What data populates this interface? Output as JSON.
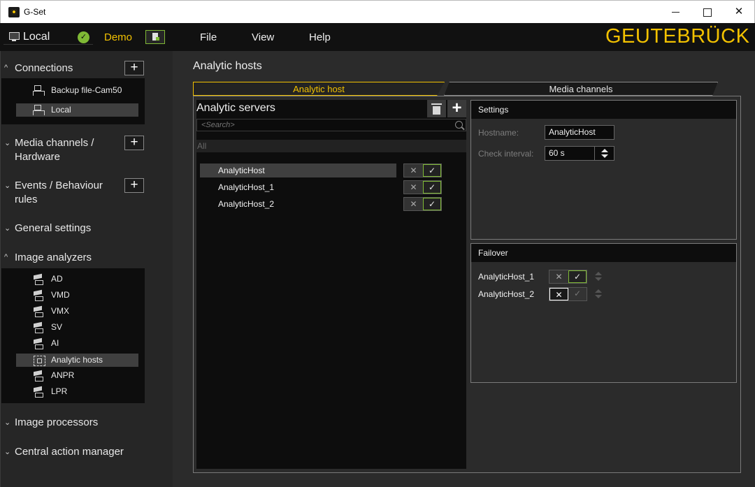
{
  "window": {
    "title": "G-Set",
    "minimize_glyph": "",
    "maximize_glyph": "",
    "close_glyph": "✕"
  },
  "menubar": {
    "connection": "Local",
    "connection_status_glyph": "✓",
    "demo": "Demo",
    "file": "File",
    "view": "View",
    "help": "Help",
    "brand": "GEUTEBRÜCK"
  },
  "sidebar": {
    "connections": {
      "title": "Connections",
      "add": "+",
      "items": [
        {
          "label": "Backup file-Cam50",
          "icon": "network-icon"
        },
        {
          "label": "Local",
          "icon": "network-icon",
          "selected": true
        }
      ]
    },
    "media_channels": {
      "title_line1": "Media channels /",
      "title_line2": "Hardware",
      "add": "+"
    },
    "events": {
      "title_line1": "Events / Behaviour",
      "title_line2": "rules",
      "add": "+"
    },
    "general_settings": {
      "title": "General settings"
    },
    "image_analyzers": {
      "title": "Image analyzers",
      "items": [
        {
          "label": "AD",
          "icon": "camera-analyzer-icon"
        },
        {
          "label": "VMD",
          "icon": "camera-analyzer-icon"
        },
        {
          "label": "VMX",
          "icon": "camera-analyzer-icon"
        },
        {
          "label": "SV",
          "icon": "camera-analyzer-icon"
        },
        {
          "label": "AI",
          "icon": "camera-analyzer-icon"
        },
        {
          "label": "Analytic hosts",
          "icon": "analytic-hosts-icon",
          "selected": true
        },
        {
          "label": "ANPR",
          "icon": "camera-analyzer-icon"
        },
        {
          "label": "LPR",
          "icon": "camera-analyzer-icon"
        }
      ]
    },
    "image_processors": {
      "title": "Image processors"
    },
    "central_action_manager": {
      "title": "Central action manager"
    },
    "chevron": "^"
  },
  "main": {
    "page_title": "Analytic hosts",
    "tabs": [
      {
        "label": "Analytic host",
        "active": true
      },
      {
        "label": "Media channels",
        "active": false
      }
    ],
    "servers": {
      "title": "Analytic servers",
      "add": "+",
      "search_placeholder": "<Search>",
      "filter": "All",
      "rows": [
        {
          "name": "AnalyticHost",
          "enabled": true,
          "selected": true
        },
        {
          "name": "AnalyticHost_1",
          "enabled": true
        },
        {
          "name": "AnalyticHost_2",
          "enabled": true
        }
      ]
    },
    "settings": {
      "title": "Settings",
      "hostname_label": "Hostname:",
      "hostname_value": "AnalyticHost",
      "interval_label": "Check interval:",
      "interval_value": "60 s"
    },
    "failover": {
      "title": "Failover",
      "rows": [
        {
          "name": "AnalyticHost_1",
          "enabled": true
        },
        {
          "name": "AnalyticHost_2",
          "enabled": false
        }
      ]
    },
    "toggle_off_glyph": "✕",
    "toggle_on_glyph": "✓"
  },
  "colors": {
    "accent_yellow": "#f2c100",
    "ok_green": "#7fb935",
    "background": "#2b2b2b",
    "panel_black": "#0d0d0d"
  }
}
